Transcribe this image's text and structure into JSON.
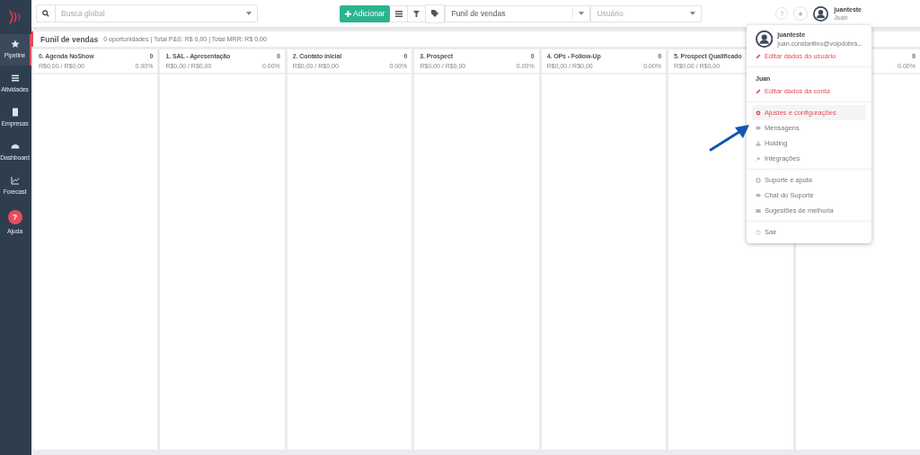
{
  "sidebar": {
    "items": [
      {
        "label": "Pipeline",
        "selected": true,
        "kind": "star"
      },
      {
        "label": "Atividades",
        "selected": false,
        "kind": "list"
      },
      {
        "label": "Empresas",
        "selected": false,
        "kind": "building"
      },
      {
        "label": "Dashboard",
        "selected": false,
        "kind": "gauge"
      },
      {
        "label": "Forecast",
        "selected": false,
        "kind": "chart"
      },
      {
        "label": "Ajuda",
        "selected": false,
        "kind": "help",
        "icon": "?"
      }
    ]
  },
  "topbar": {
    "search": {
      "placeholder": "Busca global"
    },
    "add_button": "Adicionar",
    "funnel_select": {
      "value": "Funil de vendas"
    },
    "user_select": {
      "placeholder": "Usuário"
    },
    "help": "?",
    "user": {
      "name": "juanteste",
      "account": "Juan"
    }
  },
  "title": {
    "name": "Funil de vendas",
    "summary": "0 oportunidades | Total P&S: R$ 0,00 | Total MRR: R$ 0,00"
  },
  "columns": [
    {
      "title": "0. Agenda NoShow",
      "count": "0",
      "amounts": "R$0,00 / R$0,00",
      "percent": "0.00%"
    },
    {
      "title": "1. SAL - Apresentação",
      "count": "0",
      "amounts": "R$0,00 / R$0,00",
      "percent": "0.00%"
    },
    {
      "title": "2. Contato inicial",
      "count": "0",
      "amounts": "R$0,00 / R$0,00",
      "percent": "0.00%"
    },
    {
      "title": "3. Prospect",
      "count": "0",
      "amounts": "R$0,00 / R$0,00",
      "percent": "0.00%"
    },
    {
      "title": "4. OPs - Follow-Up",
      "count": "0",
      "amounts": "R$0,00 / R$0,00",
      "percent": "0.00%"
    },
    {
      "title": "5. Prospect Qualificado",
      "amounts": "R$0,00 / R$0,00"
    },
    {
      "count": "0",
      "percent": "0.00%"
    }
  ],
  "dropdown": {
    "user": {
      "name": "juanteste",
      "email": "juan.constantino@voipdobra..."
    },
    "edit_user": "Editar dados do usuário",
    "account": {
      "name": "Juan",
      "edit": "Editar dados da conta"
    },
    "groups": [
      [
        {
          "label": "Ajustes e configurações",
          "selected": true,
          "kind": "gear"
        },
        {
          "label": "Mensagens",
          "selected": false,
          "kind": "chat"
        },
        {
          "label": "Holding",
          "selected": false,
          "kind": "sitemap"
        },
        {
          "label": "Integrações",
          "selected": false,
          "kind": "plug"
        }
      ],
      [
        {
          "label": "Suporte e ajuda",
          "selected": false,
          "kind": "lifebuoy"
        },
        {
          "label": "Chat do Suporte",
          "selected": false,
          "kind": "chat"
        },
        {
          "label": "Sugestões de melhoria",
          "selected": false,
          "kind": "list"
        }
      ],
      [
        {
          "label": "Sair",
          "selected": false,
          "kind": "power"
        }
      ]
    ]
  }
}
